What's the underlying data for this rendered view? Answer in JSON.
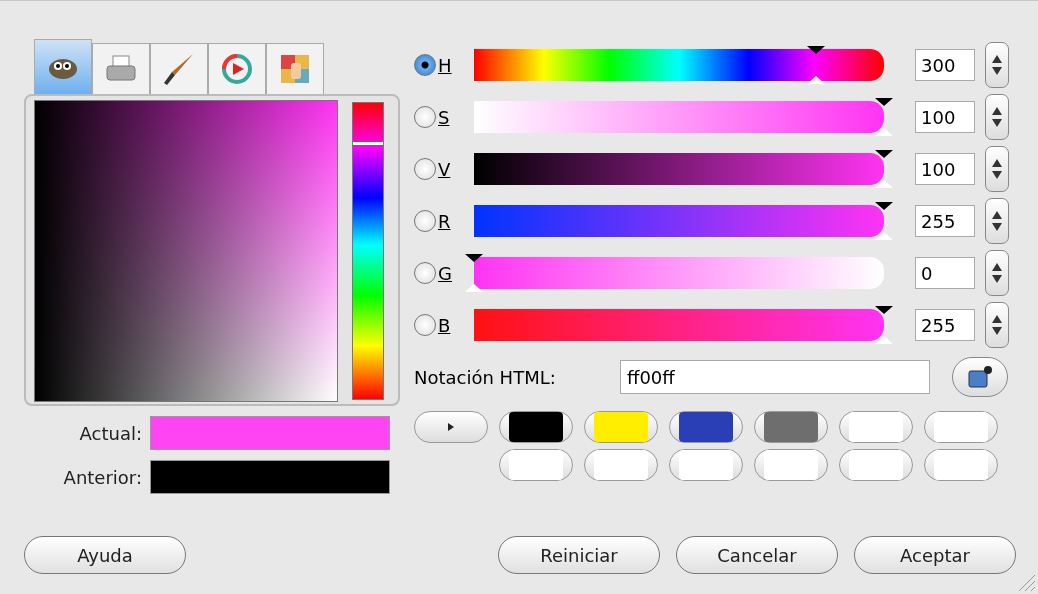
{
  "tabs": [
    {
      "kind": "mascot",
      "selected": true
    },
    {
      "kind": "printer",
      "selected": false
    },
    {
      "kind": "brush",
      "selected": false
    },
    {
      "kind": "wheel",
      "selected": false
    },
    {
      "kind": "palette",
      "selected": false
    }
  ],
  "channels": [
    {
      "kind": "hue",
      "label": "H",
      "selected": true,
      "level": 0.833,
      "value": "300"
    },
    {
      "kind": "saturation",
      "label": "S",
      "selected": false,
      "level": 1,
      "value": "100"
    },
    {
      "kind": "value",
      "label": "V",
      "selected": false,
      "level": 1,
      "value": "100"
    },
    {
      "kind": "red",
      "label": "R",
      "selected": false,
      "level": 1,
      "value": "255"
    },
    {
      "kind": "green",
      "label": "G",
      "selected": false,
      "level": 0,
      "value": "0"
    },
    {
      "kind": "blue",
      "label": "B",
      "selected": false,
      "level": 1,
      "value": "255"
    }
  ],
  "html_notation": {
    "label": "Notación HTML:",
    "value": "ff00ff"
  },
  "current": {
    "label": "Actual:",
    "color": "#ff44f4"
  },
  "previous": {
    "label": "Anterior:",
    "color": "#000000"
  },
  "history": [
    {
      "color": "#000000"
    },
    {
      "color": "#ffee00"
    },
    {
      "color": "#2a3fb5"
    },
    {
      "color": "#6e6e6e"
    },
    {
      "color": "#ffffff"
    },
    {
      "color": "#ffffff"
    },
    {
      "color": "#ffffff"
    },
    {
      "color": "#ffffff"
    },
    {
      "color": "#ffffff"
    },
    {
      "color": "#ffffff"
    },
    {
      "color": "#ffffff"
    },
    {
      "color": "#ffffff"
    }
  ],
  "buttons": [
    {
      "label": "Ayuda"
    },
    {
      "label": "Reiniciar"
    },
    {
      "label": "Cancelar"
    },
    {
      "label": "Aceptar"
    }
  ]
}
